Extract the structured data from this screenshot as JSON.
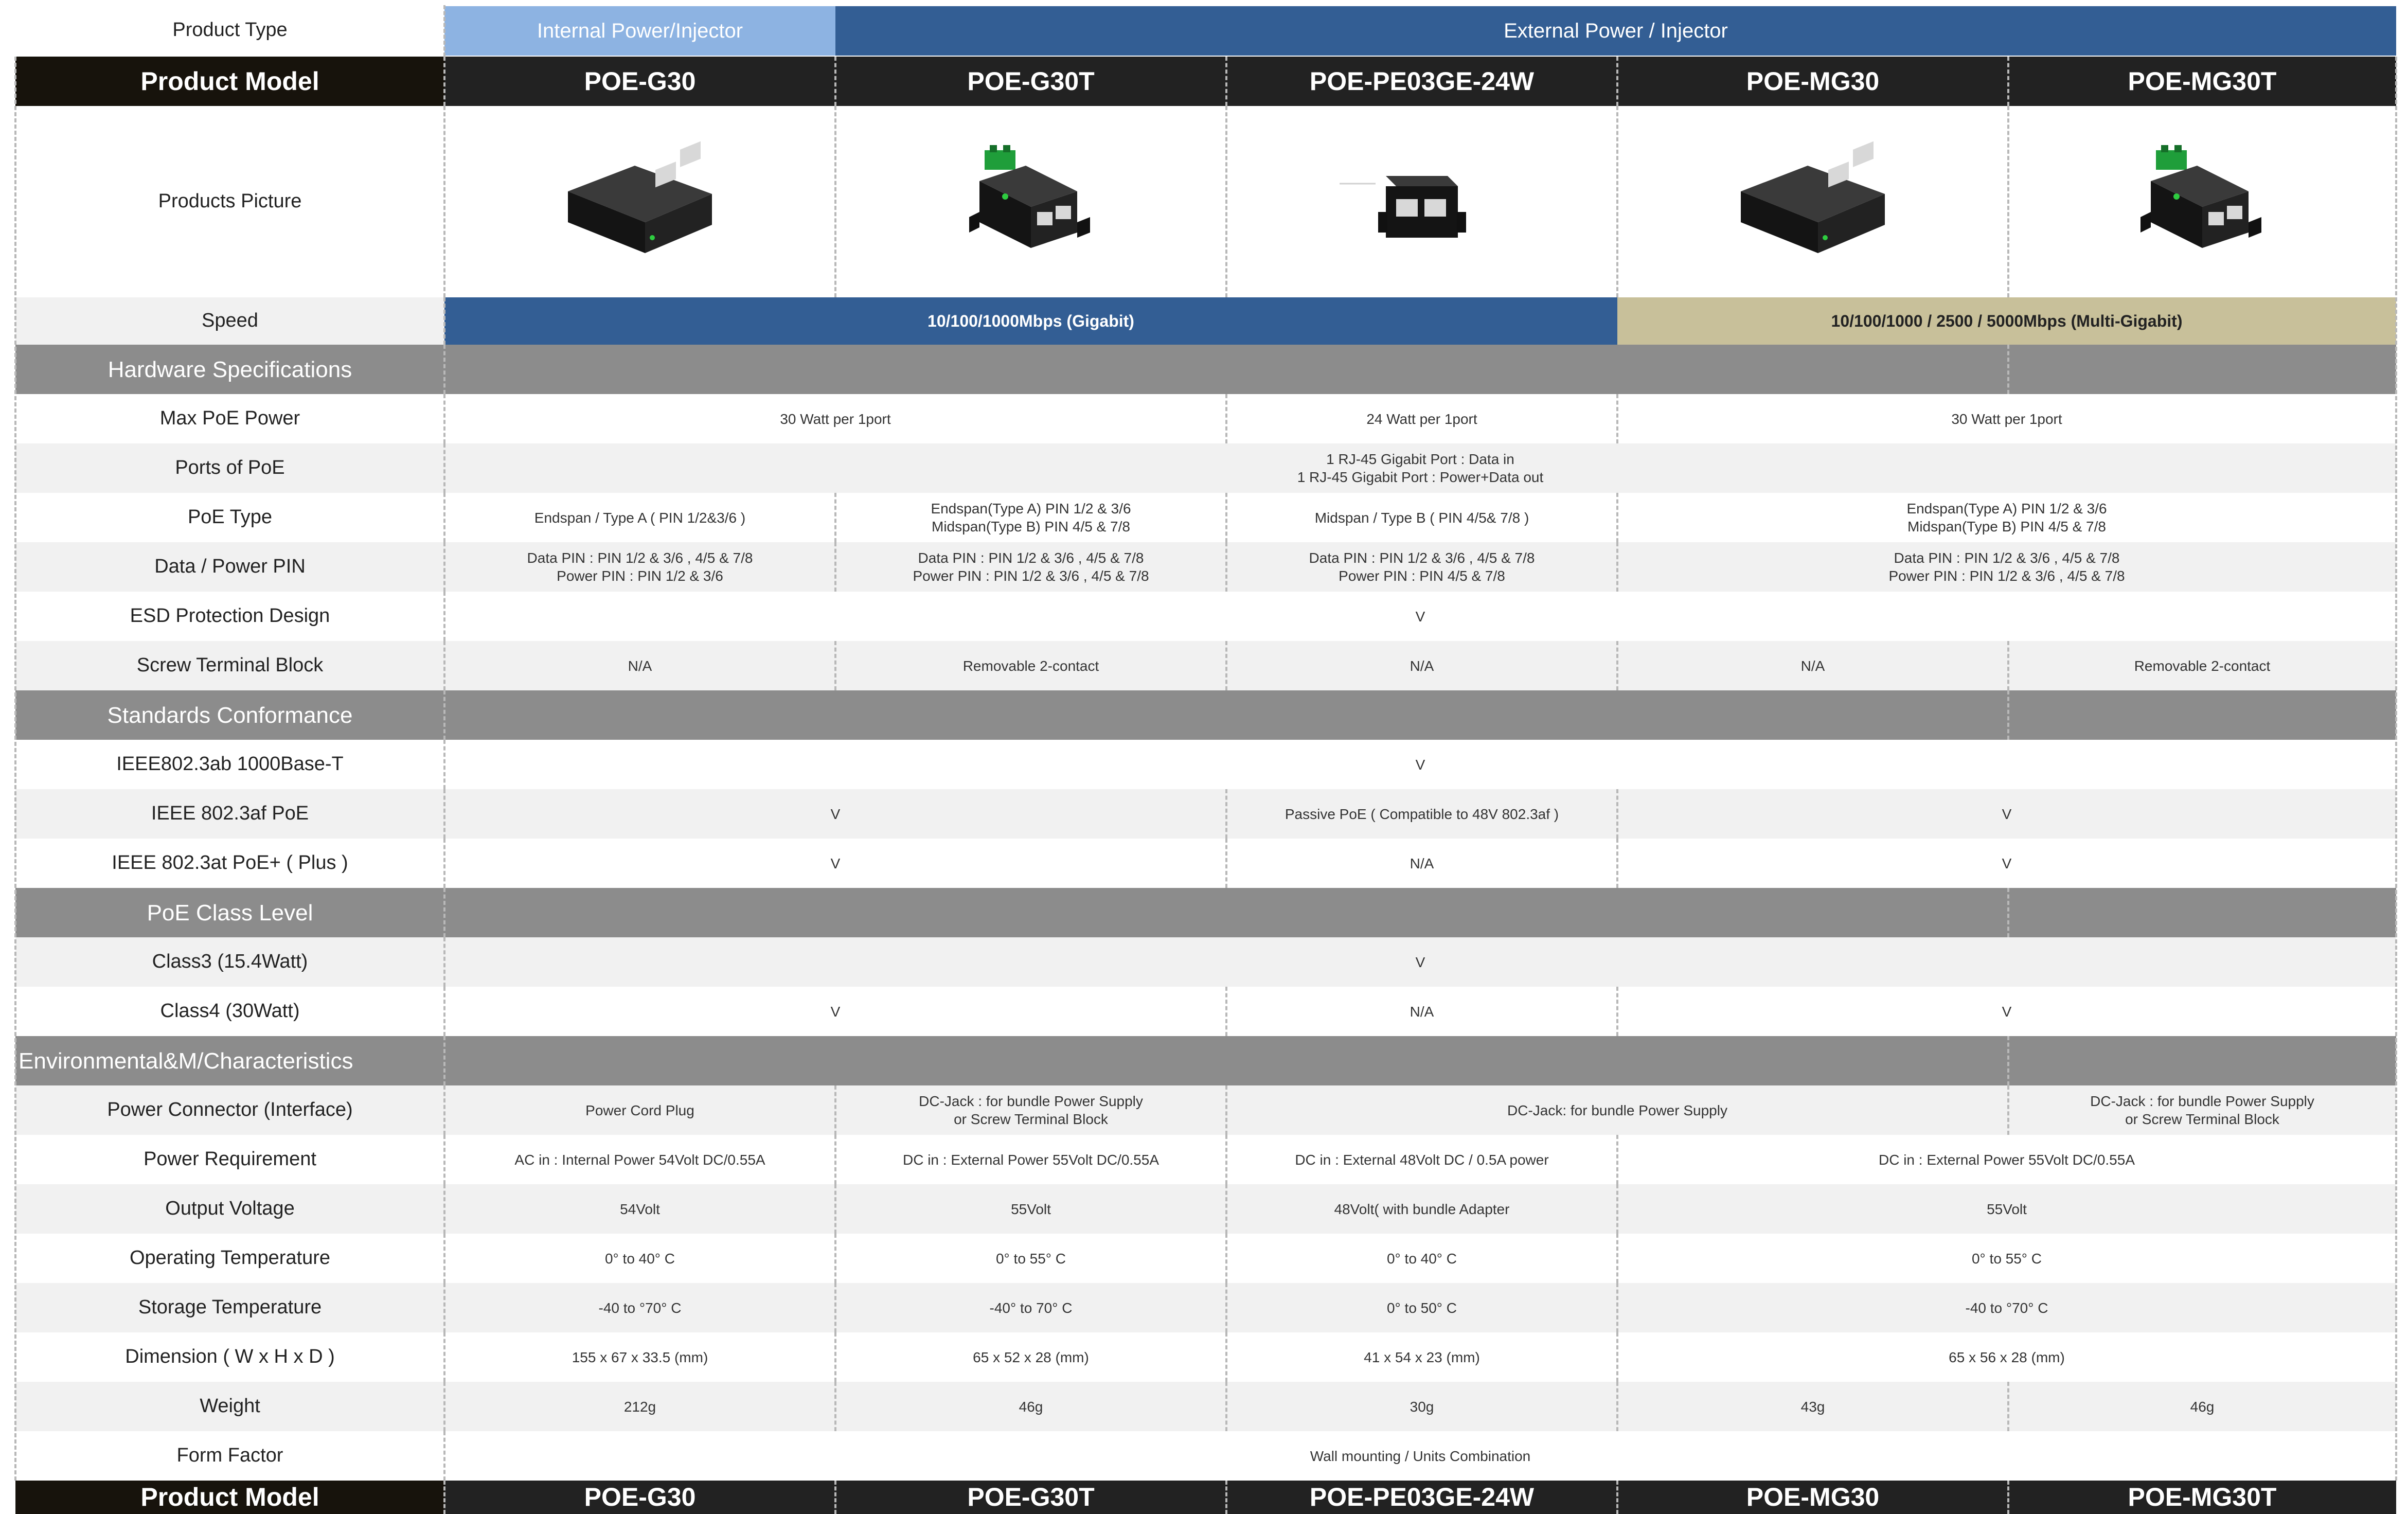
{
  "colors": {
    "internal_header": "#8db3e2",
    "external_header": "#335e94",
    "model_bar": "#222222",
    "model_label_bg": "#17130c",
    "section_bar": "#8c8c8c",
    "stripe": "#f1f1f1",
    "speed_gigabit": "#335e94",
    "speed_multigig": "#c8c09a"
  },
  "product_type": {
    "label": "Product Type",
    "internal": "Internal Power/Injector",
    "external": "External Power / Injector"
  },
  "product_model_label": "Product Model",
  "models": [
    "POE-G30",
    "POE-G30T",
    "POE-PE03GE-24W",
    "POE-MG30",
    "POE-MG30T"
  ],
  "products_picture_label": "Products Picture",
  "pictures": [
    "poe-injector-icon",
    "poe-injector-terminal-icon",
    "poe-injector-small-icon",
    "poe-injector-icon",
    "poe-injector-terminal-icon"
  ],
  "speed": {
    "label": "Speed",
    "gigabit": "10/100/1000Mbps (Gigabit)",
    "multigig": "10/100/1000 / 2500 / 5000Mbps (Multi-Gigabit)"
  },
  "sections": {
    "hardware": "Hardware Specifications",
    "standards": "Standards Conformance",
    "class_level": "PoE Class Level",
    "environmental": "Environmental&M/Characteristics"
  },
  "rows": [
    {
      "label": "Max PoE Power",
      "values": [
        "30 Watt per 1port",
        "24 Watt per 1port",
        "30 Watt per 1port"
      ]
    },
    {
      "label": "Ports of PoE",
      "values": [
        "1  RJ-45 Gigabit Port : Data in\n1  RJ-45 Gigabit Port : Power+Data out"
      ]
    },
    {
      "label": "PoE Type",
      "values": [
        "Endspan / Type A ( PIN 1/2&3/6 )",
        "Endspan(Type A) PIN 1/2 & 3/6\nMidspan(Type B) PIN 4/5 & 7/8",
        "Midspan / Type B ( PIN 4/5& 7/8 )",
        "Endspan(Type A) PIN 1/2 & 3/6\nMidspan(Type B) PIN 4/5 & 7/8"
      ]
    },
    {
      "label": "Data / Power  PIN",
      "values": [
        "Data PIN : PIN 1/2 & 3/6  , 4/5 & 7/8\nPower PIN : PIN 1/2 & 3/6",
        "Data PIN : PIN 1/2 & 3/6  , 4/5 & 7/8\nPower PIN : PIN 1/2 & 3/6  , 4/5 & 7/8",
        "Data PIN : PIN 1/2 & 3/6  , 4/5 & 7/8\nPower PIN : PIN 4/5 & 7/8",
        "Data PIN : PIN 1/2 & 3/6  , 4/5 & 7/8\nPower PIN : PIN 1/2 & 3/6  , 4/5 & 7/8"
      ]
    },
    {
      "label": "ESD Protection Design",
      "values": [
        "V"
      ]
    },
    {
      "label": "Screw Terminal Block",
      "values": [
        "N/A",
        "Removable 2-contact",
        "N/A",
        "N/A",
        "Removable 2-contact"
      ]
    },
    {
      "label": "IEEE802.3ab 1000Base-T",
      "values": [
        "V"
      ]
    },
    {
      "label": "IEEE 802.3af PoE",
      "values": [
        "V",
        "Passive PoE ( Compatible  to 48V 802.3af )",
        "V"
      ]
    },
    {
      "label": "IEEE 802.3at PoE+ ( Plus )",
      "values": [
        "V",
        "N/A",
        "V"
      ]
    },
    {
      "label": "Class3 (15.4Watt)",
      "values": [
        "V"
      ]
    },
    {
      "label": "Class4 (30Watt)",
      "values": [
        "V",
        "N/A",
        "V"
      ]
    },
    {
      "label": "Power Connector (Interface)",
      "values": [
        "Power Cord Plug",
        "DC-Jack : for bundle Power Supply\nor Screw Terminal Block",
        "DC-Jack: for bundle Power Supply",
        "DC-Jack : for bundle Power Supply\nor Screw Terminal Block"
      ]
    },
    {
      "label": "Power Requirement",
      "values": [
        "AC in : Internal Power 54Volt DC/0.55A",
        "DC in : External Power 55Volt DC/0.55A",
        "DC in : External 48Volt DC / 0.5A power",
        "DC in : External Power 55Volt DC/0.55A"
      ]
    },
    {
      "label": "Output Voltage",
      "values": [
        "54Volt",
        "55Volt",
        "48Volt( with bundle Adapter",
        "55Volt"
      ]
    },
    {
      "label": "Operating Temperature",
      "values": [
        "0° to 40° C",
        "0° to 55° C",
        "0° to 40° C",
        "0° to 55° C"
      ]
    },
    {
      "label": "Storage Temperature",
      "values": [
        "-40 to °70° C",
        "-40° to 70° C",
        "0° to 50° C",
        "-40 to °70° C"
      ]
    },
    {
      "label": "Dimension ( W x H x D )",
      "values": [
        "155 x 67 x 33.5 (mm)",
        "65 x 52 x 28  (mm)",
        "41 x 54 x 23  (mm)",
        "65 x 56 x 28 (mm)"
      ]
    },
    {
      "label": "Weight",
      "values": [
        "212g",
        "46g",
        "30g",
        "43g",
        "46g"
      ]
    },
    {
      "label": "Form Factor",
      "values": [
        "Wall mounting / Units Combination"
      ]
    }
  ]
}
